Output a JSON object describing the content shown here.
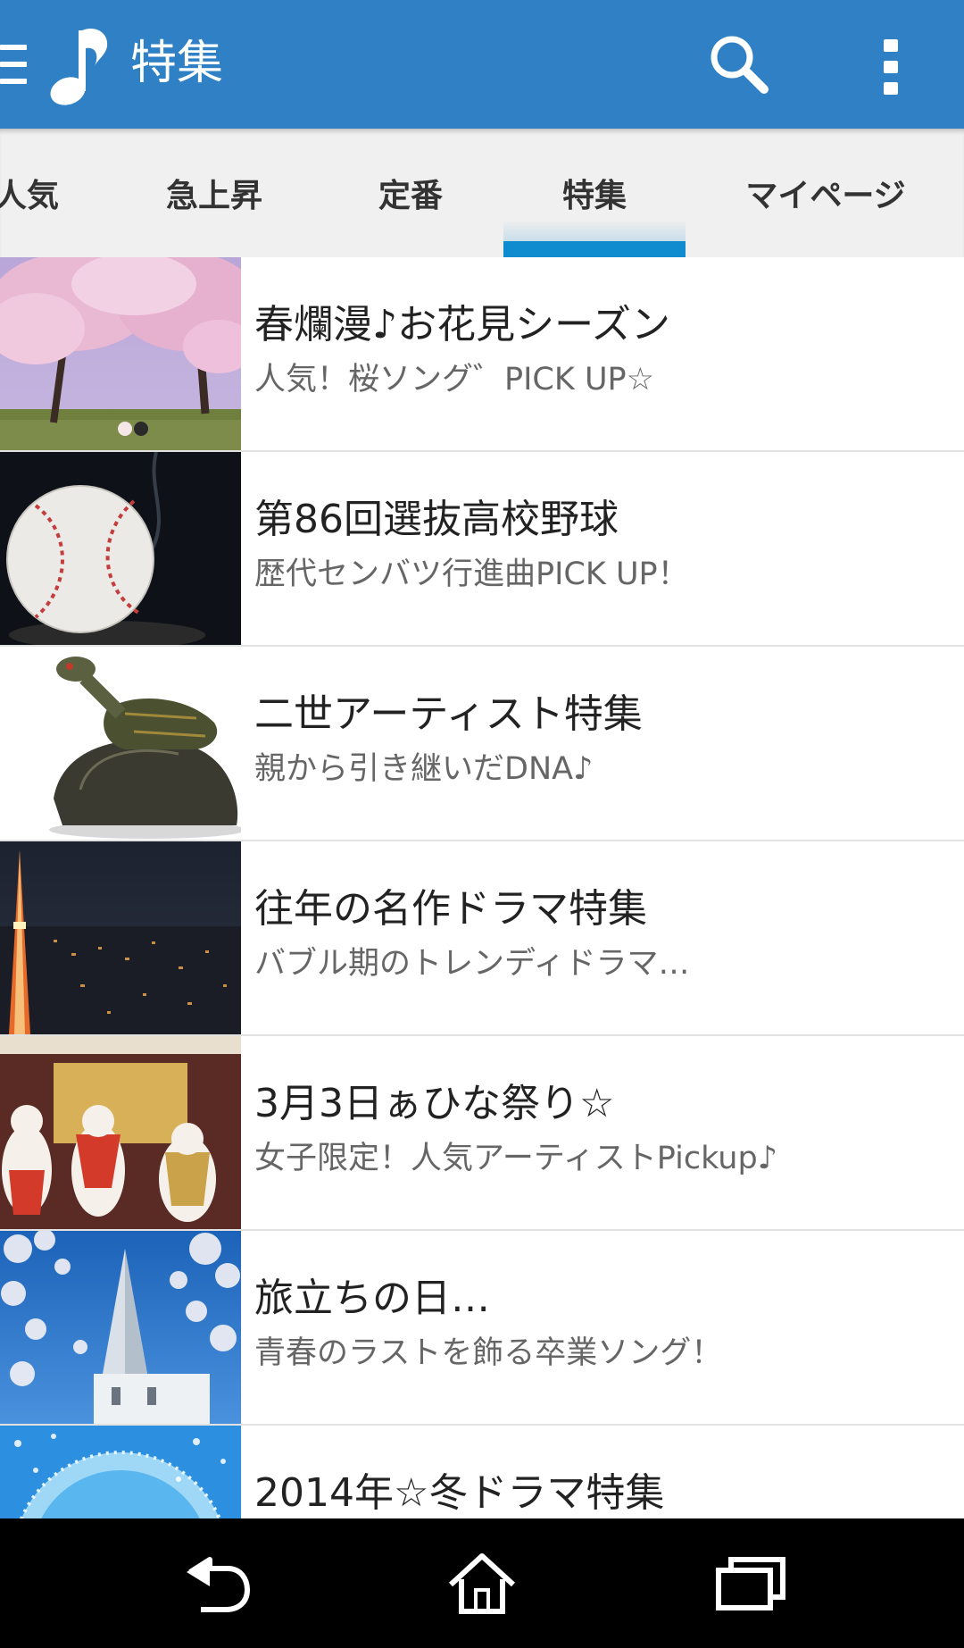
{
  "appbar": {
    "title": "特集",
    "icons": [
      "menu-icon",
      "music-note-icon",
      "search-icon",
      "more-vert-icon"
    ],
    "color": "#2f80c4"
  },
  "tabs": [
    {
      "label": "人気",
      "selected": false
    },
    {
      "label": "急上昇",
      "selected": false
    },
    {
      "label": "定番",
      "selected": false
    },
    {
      "label": "特集",
      "selected": true
    },
    {
      "label": "マイページ",
      "selected": false
    }
  ],
  "tab_indicator_color": "#0f8bd0",
  "features": [
    {
      "title": "春爛漫♪お花見シーズン",
      "subtitle": "人気！桜ソング゛PICK UP☆",
      "thumbnail": "cherry-blossom-trees"
    },
    {
      "title": "第86回選抜高校野球",
      "subtitle": "歴代センバツ行進曲PICK UP！",
      "thumbnail": "baseball"
    },
    {
      "title": "二世アーティスト特集",
      "subtitle": "親から引き継いだDNA♪",
      "thumbnail": "turtles"
    },
    {
      "title": "往年の名作ドラマ特集",
      "subtitle": "バブル期のトレンディドラマ…",
      "thumbnail": "tokyo-tower-night"
    },
    {
      "title": "3月3日ぁひな祭り☆",
      "subtitle": "女子限定！人気アーティストPickup♪",
      "thumbnail": "hina-dolls"
    },
    {
      "title": "旅立ちの日…",
      "subtitle": "青春のラストを飾る卒業ソング！",
      "thumbnail": "church-cherry-blossom"
    },
    {
      "title": "2014年☆冬ドラマ特集",
      "subtitle": "",
      "thumbnail": "snow-ornament"
    }
  ],
  "navbar": {
    "icons": [
      "back-icon",
      "home-icon",
      "recent-apps-icon"
    ]
  }
}
